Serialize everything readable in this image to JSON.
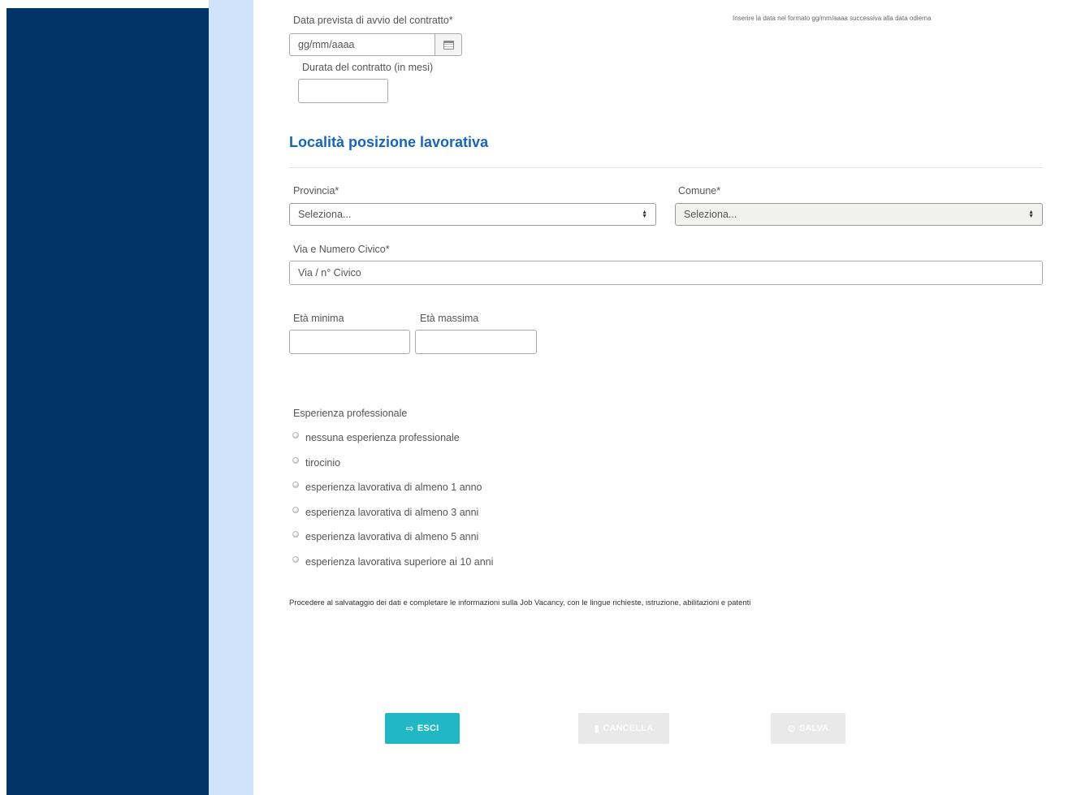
{
  "contract": {
    "start_date_label": "Data prevista di avvio del contratto*",
    "start_date_placeholder": "gg/mm/aaaa",
    "start_date_hint": "Inserire la data nel formato gg/mm/aaaa successiva alla data odierna",
    "duration_label": "Durata del contratto (in mesi)",
    "duration_value": ""
  },
  "location": {
    "section_title": "Località posizione lavorativa",
    "province_label": "Provincia*",
    "province_selected": "Seleziona...",
    "comune_label": "Comune*",
    "comune_selected": "Seleziona...",
    "address_label": "Via e Numero Civico*",
    "address_placeholder": "Via / n° Civico"
  },
  "age": {
    "min_label": "Età minima",
    "max_label": "Età massima",
    "min_value": "",
    "max_value": ""
  },
  "experience": {
    "label": "Esperienza professionale",
    "options": [
      "nessuna esperienza professionale",
      "tirocinio",
      "esperienza lavorativa di almeno 1 anno",
      "esperienza lavorativa di almeno 3 anni",
      "esperienza lavorativa di almeno 5 anni",
      "esperienza lavorativa superiore ai 10 anni"
    ]
  },
  "note": "Procedere al salvataggio dei dati e completare le informazioni sulla Job Vacancy, con le lingue richieste, istruzione, abilitazioni e patenti",
  "actions": {
    "exit_label": "ESCI",
    "delete_label": "CANCELLA",
    "save_label": "SALVA"
  },
  "colors": {
    "sidebar": "#003366",
    "sidebar_accent": "#cfe3fb",
    "section_title": "#1565c0",
    "exit_button": "#1fb8c4",
    "disabled_button": "#e9e9e9"
  },
  "icons": {
    "calendar": "calendar-icon",
    "exit": "exit-icon",
    "delete": "trash-icon",
    "save": "check-circle-icon"
  }
}
